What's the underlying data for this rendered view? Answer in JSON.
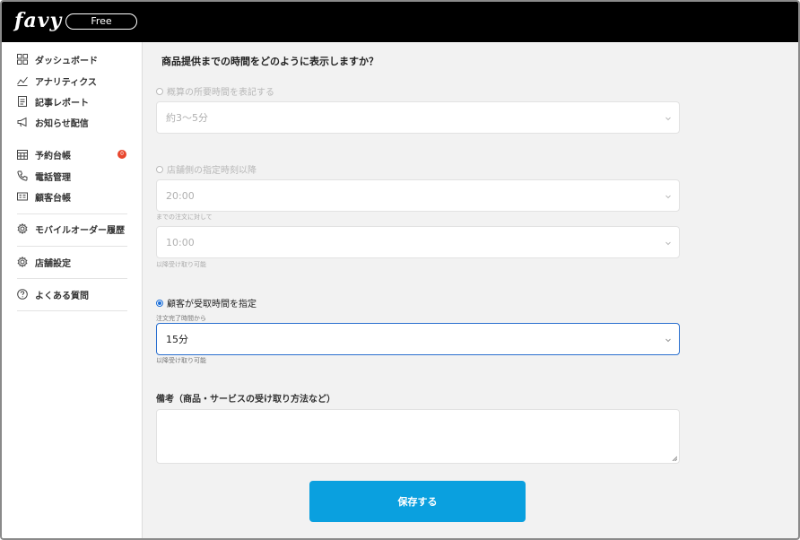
{
  "app": {
    "logo": "favy",
    "plan": "Free"
  },
  "sidebar": {
    "items": [
      {
        "label": "ダッシュボード",
        "icon": "dashboard-icon"
      },
      {
        "label": "アナリティクス",
        "icon": "analytics-icon"
      },
      {
        "label": "記事レポート",
        "icon": "report-icon"
      },
      {
        "label": "お知らせ配信",
        "icon": "megaphone-icon"
      },
      {
        "label": "予約台帳",
        "icon": "calendar-icon",
        "badge": "0"
      },
      {
        "label": "電話管理",
        "icon": "phone-icon"
      },
      {
        "label": "顧客台帳",
        "icon": "id-card-icon"
      },
      {
        "label": "モバイルオーダー履歴",
        "icon": "gear-icon"
      },
      {
        "label": "店舗設定",
        "icon": "gear-icon"
      },
      {
        "label": "よくある質問",
        "icon": "question-icon"
      }
    ]
  },
  "form": {
    "heading": "商品提供までの時間をどのように表示しますか？",
    "option1": {
      "label": "概算の所要時間を表記する",
      "select_value": "約3〜5分"
    },
    "option2": {
      "label": "店舗側の指定時刻以降",
      "select1_value": "20:00",
      "hint1": "までの注文に対して",
      "select2_value": "10:00",
      "hint2": "以降受け取り可能"
    },
    "option3": {
      "label": "顧客が受取時間を指定",
      "hint_top": "注文完了時間から",
      "select_value": "15分",
      "hint_bottom": "以降受け取り可能"
    },
    "notes_title": "備考（商品・サービスの受け取り方法など）",
    "notes_value": "",
    "save_label": "保存する"
  },
  "colors": {
    "accent": "#0aa0df",
    "badge": "#e8472e",
    "radio": "#1d6fd8"
  }
}
